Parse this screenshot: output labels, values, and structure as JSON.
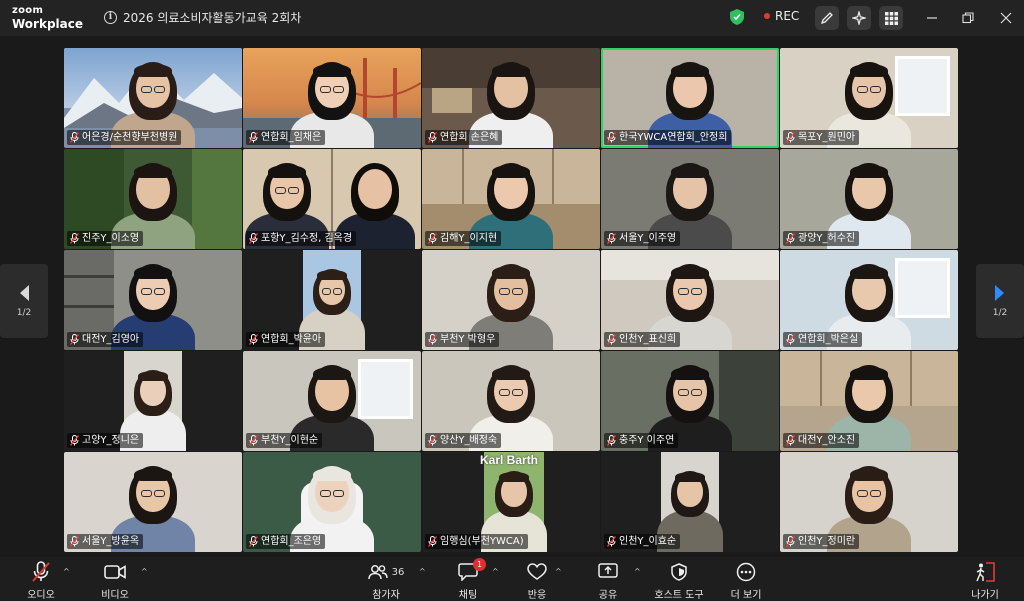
{
  "app": {
    "logo_line1": "zoom",
    "logo_line2": "Workplace",
    "meeting_title": "2026 의료소비자활동가교육 2회차",
    "rec_label": "REC"
  },
  "nav": {
    "page_left": "1/2",
    "page_right": "1/2"
  },
  "participants": [
    {
      "name": "어은경/순천향부천병원",
      "bg": "#7d8fa8",
      "hair": "#2a1d17",
      "skin": "#e7c3a6",
      "shirt": "#c0a68d",
      "glasses": true,
      "scene": "mountain"
    },
    {
      "name": "연합회_임채은",
      "bg": "#d99a55",
      "hair": "#121212",
      "skin": "#efcfb5",
      "shirt": "#e8e8e8",
      "glasses": true,
      "scene": "bridge"
    },
    {
      "name": "연합회 손은혜",
      "bg": "#6b5a4b",
      "hair": "#1a1512",
      "skin": "#e5c1a3",
      "shirt": "#efefef",
      "glasses": false,
      "scene": "room"
    },
    {
      "name": "한국YWCA연합회_안정희",
      "bg": "#b9b2a6",
      "hair": "#181410",
      "skin": "#ebc8ad",
      "shirt": "#3e5fa6",
      "glasses": false,
      "scene": "plain",
      "active": true
    },
    {
      "name": "목포Y_원민아",
      "bg": "#d9d2c4",
      "hair": "#18130f",
      "skin": "#e6c6ab",
      "shirt": "#eae7df",
      "glasses": true,
      "scene": "window"
    },
    {
      "name": "진주Y_이소영",
      "bg": "#3e5a34",
      "hair": "#1b1410",
      "skin": "#e4c0a3",
      "shirt": "#8fa381",
      "glasses": false,
      "scene": "plant"
    },
    {
      "name": "포항Y_김수정, 김옥경",
      "bg": "#d8c8b0",
      "hair": "#15110e",
      "skin": "#e9c6a8",
      "shirt": "#2a2e3a",
      "glasses": true,
      "scene": "double"
    },
    {
      "name": "김해Y_이지현",
      "bg": "#a38d6c",
      "hair": "#16120f",
      "skin": "#ecc9ac",
      "shirt": "#2f6f7a",
      "glasses": false,
      "scene": "cabinet"
    },
    {
      "name": "서울Y_이주영",
      "bg": "#7b7b74",
      "hair": "#1b1714",
      "skin": "#e4c3a7",
      "shirt": "#4b4b4b",
      "glasses": false,
      "scene": "empty"
    },
    {
      "name": "광양Y_허수진",
      "bg": "#a7a79c",
      "hair": "#17120e",
      "skin": "#e8c7aa",
      "shirt": "#dfe8ef",
      "glasses": false,
      "scene": "plain"
    },
    {
      "name": "대전Y_김영아",
      "bg": "#8d8f88",
      "hair": "#121010",
      "skin": "#ecccb2",
      "shirt": "#253d73",
      "glasses": true,
      "scene": "shelf"
    },
    {
      "name": "연합회_박윤아",
      "bg": "#1f1f1f",
      "hair": "#2b1f18",
      "skin": "#e8c6a9",
      "shirt": "#d7d0c4",
      "glasses": true,
      "scene": "portrait"
    },
    {
      "name": "부천Y 박형우",
      "bg": "#d5d1c8",
      "hair": "#2a1e16",
      "skin": "#e4bf9f",
      "shirt": "#7f7d78",
      "glasses": true,
      "scene": "plain"
    },
    {
      "name": "인천Y_표신희",
      "bg": "#cfc9bf",
      "hair": "#1d1612",
      "skin": "#e9c8ad",
      "shirt": "#d8d6d1",
      "glasses": true,
      "scene": "ceiling"
    },
    {
      "name": "연합회_박은실",
      "bg": "#cfdbe3",
      "hair": "#1c1612",
      "skin": "#e8c9ae",
      "shirt": "#e9ecef",
      "glasses": false,
      "scene": "office"
    },
    {
      "name": "고양Y_정니은",
      "bg": "#1f1f1f",
      "hair": "#2a1e17",
      "skin": "#ead0bb",
      "shirt": "#eeeeee",
      "glasses": false,
      "scene": "portrait"
    },
    {
      "name": "부천Y_이현순",
      "bg": "#c9c6bd",
      "hair": "#1d1713",
      "skin": "#e7c2a3",
      "shirt": "#2a2a2a",
      "glasses": false,
      "scene": "window"
    },
    {
      "name": "양산Y_배정숙",
      "bg": "#cbc6bc",
      "hair": "#221a15",
      "skin": "#ebcab0",
      "shirt": "#f0efea",
      "glasses": true,
      "scene": "plain"
    },
    {
      "name": "충주Y 이주연",
      "bg": "#6a6f63",
      "hair": "#151110",
      "skin": "#e6c4a8",
      "shirt": "#1e1e1e",
      "glasses": true,
      "scene": "dark"
    },
    {
      "name": "대전Y_안소진",
      "bg": "#b5a58f",
      "hair": "#161210",
      "skin": "#e9c8ac",
      "shirt": "#9db4a9",
      "glasses": false,
      "scene": "cabinet"
    },
    {
      "name": "서울Y_방윤옥",
      "bg": "#d9d5ce",
      "hair": "#1c1613",
      "skin": "#e8c6a8",
      "shirt": "#6f84a6",
      "glasses": true,
      "scene": "plain"
    },
    {
      "name": "연합회_조은영",
      "bg": "#3c5b47",
      "hair": "#e9e6e0",
      "skin": "#edd2bd",
      "shirt": "#f2f2f2",
      "glasses": true,
      "scene": "chair"
    },
    {
      "name": "임행심(부천YWCA)",
      "bg": "#1f1f1f",
      "hair": "#2a1d16",
      "skin": "#e6c5a8",
      "shirt": "#e6e3d7",
      "glasses": false,
      "scene": "karl",
      "sign": "Karl Barth"
    },
    {
      "name": "인천Y_이효순",
      "bg": "#1f1f1f",
      "hair": "#201814",
      "skin": "#e6c4a6",
      "shirt": "#6f6a60",
      "glasses": false,
      "scene": "portrait"
    },
    {
      "name": "인천Y_정미란",
      "bg": "#d6d3cc",
      "hair": "#2a1d16",
      "skin": "#e8c4a4",
      "shirt": "#b2a38d",
      "glasses": true,
      "scene": "plain"
    }
  ],
  "toolbar": {
    "audio": "오디오",
    "video": "비디오",
    "participants": "참가자",
    "participants_count": "36",
    "chat": "채팅",
    "chat_badge": "1",
    "react": "반응",
    "share": "공유",
    "host_tools": "호스트 도구",
    "more": "더 보기",
    "leave": "나가기"
  },
  "colors": {
    "active_border": "#2fd36b",
    "rec_dot": "#e53935",
    "badge": "#e02f2f",
    "shield": "#2fbf5f"
  }
}
